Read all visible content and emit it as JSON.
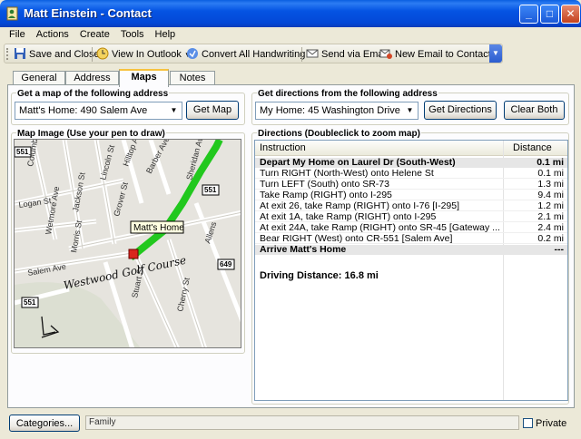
{
  "window": {
    "title": "Matt Einstein - Contact"
  },
  "menu": [
    "File",
    "Actions",
    "Create",
    "Tools",
    "Help"
  ],
  "toolbar": {
    "save_close": "Save and Close",
    "view_outlook": "View In Outlook",
    "convert": "Convert All Handwriting",
    "send_email": "Send via Email",
    "new_email": "New Email to Contact"
  },
  "tabs": [
    {
      "label": "General",
      "active": false
    },
    {
      "label": "Address",
      "active": false
    },
    {
      "label": "Maps",
      "active": true
    },
    {
      "label": "Notes",
      "active": false
    }
  ],
  "map_address": {
    "label": "Get a map of the following address",
    "selected": "Matt's Home: 490 Salem Ave",
    "button": "Get Map"
  },
  "directions_address": {
    "label": "Get directions from the following address",
    "selected": "My Home: 45 Washington Drive",
    "button_directions": "Get Directions",
    "button_clear": "Clear Both"
  },
  "map_image": {
    "label": "Map Image  (Use your pen to draw)",
    "marker_label": "Matt's Home",
    "streets": [
      "Barber Ave",
      "Sheridan Ave",
      "Jackson St",
      "Grover St",
      "Lincoln St",
      "Logan St",
      "Hilltop Ave",
      "Morris St",
      "Wetmore Ave",
      "Salem Ave",
      "Stuart St",
      "Columbia St",
      "Allens",
      "Cherry St"
    ],
    "route_shields": [
      "551",
      "551",
      "649",
      "551"
    ],
    "handwriting": "Westwood Golf Course",
    "route_color": "#00c800"
  },
  "directions": {
    "label": "Directions (Doubleclick to zoom map)",
    "col_instruction": "Instruction",
    "col_distance": "Distance",
    "rows": [
      {
        "instruction": "Depart My Home on Laurel Dr (South-West)",
        "distance": "0.1 mi",
        "bold": true
      },
      {
        "instruction": "Turn RIGHT (North-West) onto Helene St",
        "distance": "0.1 mi",
        "bold": false
      },
      {
        "instruction": "Turn LEFT (South) onto SR-73",
        "distance": "1.3 mi",
        "bold": false
      },
      {
        "instruction": "Take Ramp (RIGHT) onto I-295",
        "distance": "9.4 mi",
        "bold": false
      },
      {
        "instruction": "At exit 26, take Ramp (RIGHT) onto I-76 [I-295]",
        "distance": "1.2 mi",
        "bold": false
      },
      {
        "instruction": "At exit 1A, take Ramp (RIGHT) onto I-295",
        "distance": "2.1 mi",
        "bold": false
      },
      {
        "instruction": "At exit 24A, take Ramp (RIGHT) onto SR-45 [Gateway ...",
        "distance": "2.4 mi",
        "bold": false
      },
      {
        "instruction": "Bear RIGHT (West) onto CR-551 [Salem Ave]",
        "distance": "0.2 mi",
        "bold": false
      },
      {
        "instruction": "Arrive Matt's Home",
        "distance": "---",
        "bold": true
      }
    ],
    "driving_distance": "Driving Distance: 16.8 mi"
  },
  "footer": {
    "categories_button": "Categories...",
    "category_value": "Family",
    "private_label": "Private",
    "private_checked": false
  }
}
